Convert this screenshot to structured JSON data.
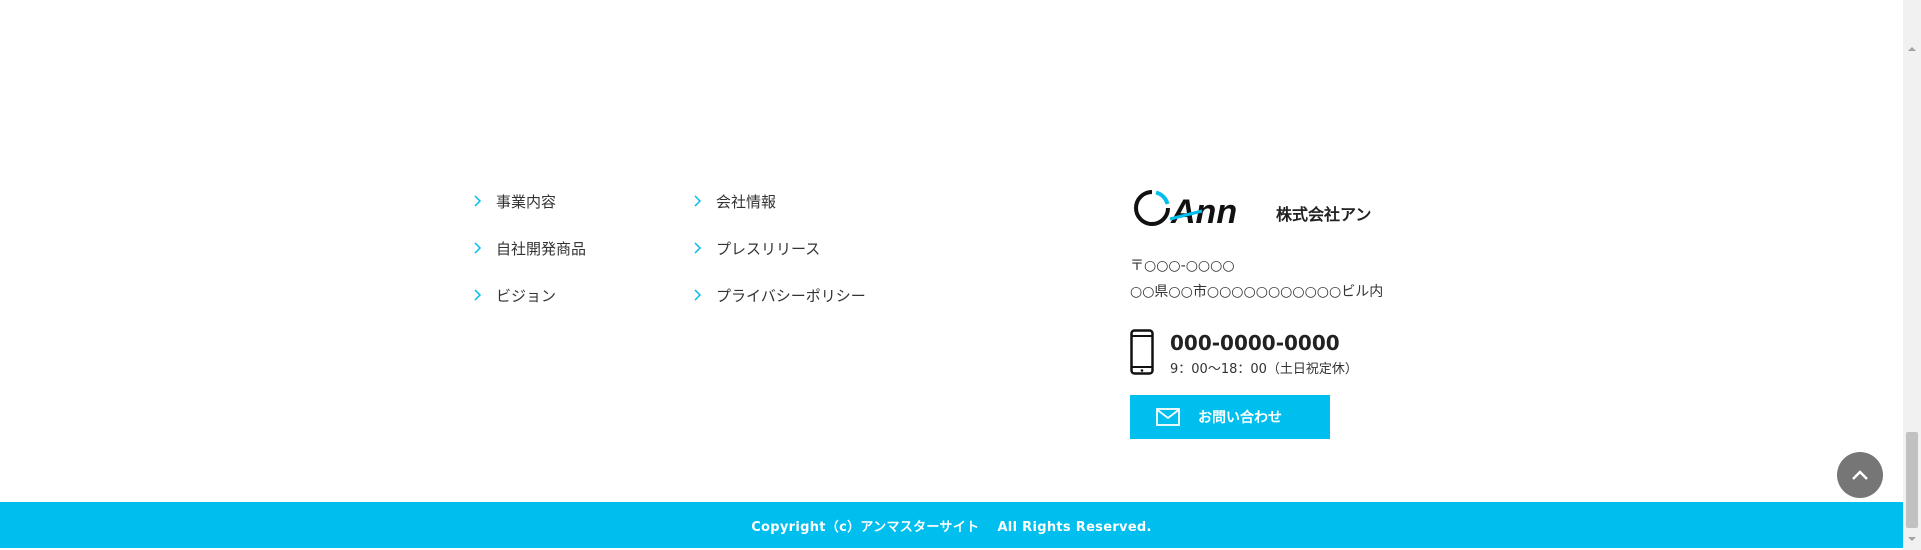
{
  "footer_nav": {
    "col1": [
      {
        "label": "事業内容"
      },
      {
        "label": "自社開発商品"
      },
      {
        "label": "ビジョン"
      }
    ],
    "col2": [
      {
        "label": "会社情報"
      },
      {
        "label": "プレスリリース"
      },
      {
        "label": "プライバシーポリシー"
      }
    ]
  },
  "company": {
    "logo_text": "Ann",
    "name": "株式会社アン",
    "postal": "〒○○○-○○○○",
    "address": "○○県○○市○○○○○○○○○○○ビル内",
    "phone": "000-0000-0000",
    "hours": "9：00〜18：00（土日祝定休）",
    "contact_label": "お問い合わせ"
  },
  "copyright": "Copyright（c）アンマスターサイト　 All Rights Reserved.",
  "colors": {
    "accent": "#00bfee",
    "to_top": "#767676",
    "text": "#222222"
  },
  "icons": {
    "chevron": "chevron-right-icon",
    "phone": "smartphone-icon",
    "mail": "mail-icon",
    "to_top": "chevron-up-icon"
  }
}
